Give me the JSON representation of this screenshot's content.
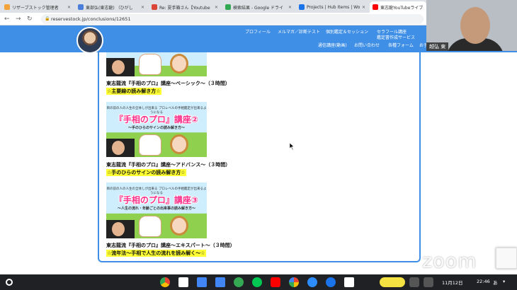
{
  "tabs": [
    {
      "label": "リザーブストック管理者",
      "color": "#f2a33a"
    },
    {
      "label": "東部弘(東志龍) （ひがし",
      "color": "#4a7ed8"
    },
    {
      "label": "Re: 夏手箱さん【Youtube",
      "color": "#db4437"
    },
    {
      "label": "検索結果 - Google ドライ",
      "color": "#34a853"
    },
    {
      "label": "Projects | Hub Items | Wo",
      "color": "#1a73e8"
    },
    {
      "label": "東志龍YouTubeライブ",
      "color": "#ff0000"
    }
  ],
  "url": "reservestock.jp/conclusions/12651",
  "nav": {
    "row1": [
      "プロフィール",
      "メルマガ／診断テスト",
      "個別鑑定＆セッション",
      "セラフール講座",
      "鑑定書作成サービス"
    ],
    "row2": [
      "通信講座(動画)",
      "お問い合わせ",
      "各種フォーム",
      "お子"
    ]
  },
  "courses": [
    {
      "title": "東志龍流『手相のプロ』講座～ベーシック～（３時間）",
      "highlight": "☆主要線の読み解き方☆"
    },
    {
      "banner_top": "目の前の人の人生の全体しが出来る プロレベルの手相鑑定が出来るようになる",
      "banner_title": "『手相のプロ』講座②",
      "banner_sub": "～手のひらのサインの読み解き方～",
      "title": "東志龍流『手相のプロ』講座～アドバンス～（３時間）",
      "highlight": "☆手のひらのサインの読み解き方☆"
    },
    {
      "banner_top": "目の前の人の人生の全体しが出来る プロレベルの手相鑑定が出来るようになる",
      "banner_title": "『手相のプロ』講座③",
      "banner_sub": "～人生の流れ・年齢ごとの出来事の読み解き方～",
      "title": "東志龍流『手相のプロ』講座～エキスパート～（３時間）",
      "highlight": "☆流年法～手相で人生の流れを読み解く～☆"
    }
  ],
  "video": {
    "name": "越弘 東"
  },
  "watermark": "zoom",
  "taskbar": {
    "date": "11月12日",
    "time": "22:46"
  }
}
